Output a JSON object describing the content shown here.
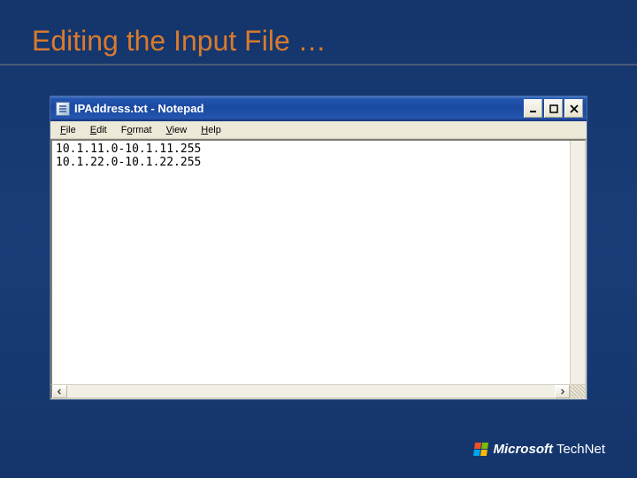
{
  "slide": {
    "title": "Editing the Input File …"
  },
  "window": {
    "title": "IPAddress.txt - Notepad"
  },
  "menu": {
    "file": "File",
    "edit": "Edit",
    "format": "Format",
    "view": "View",
    "help": "Help"
  },
  "content": {
    "lines": "10.1.11.0-10.1.11.255\n10.1.22.0-10.1.22.255"
  },
  "footer": {
    "brand1": "Microsoft",
    "brand2": "TechNet"
  }
}
